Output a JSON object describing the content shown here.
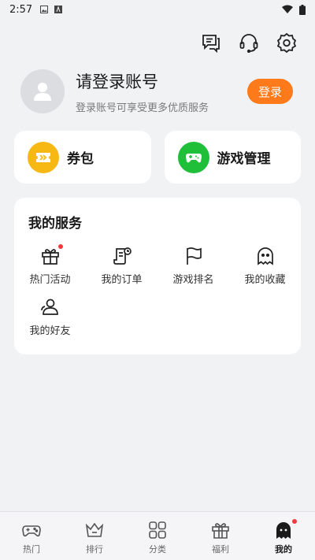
{
  "status_bar": {
    "time": "2:57"
  },
  "header": {
    "icons": [
      "message-icon",
      "headset-icon",
      "settings-icon"
    ]
  },
  "profile": {
    "title": "请登录账号",
    "subtitle": "登录账号可享受更多优质服务",
    "login_label": "登录"
  },
  "quick_cards": [
    {
      "label": "券包",
      "icon": "ticket-icon",
      "color": "#f8b814"
    },
    {
      "label": "游戏管理",
      "icon": "gamepad-icon",
      "color": "#1fbf3a"
    }
  ],
  "services": {
    "title": "我的服务",
    "items": [
      {
        "label": "热门活动",
        "icon": "gift-icon",
        "badge": true
      },
      {
        "label": "我的订单",
        "icon": "order-icon",
        "badge": false
      },
      {
        "label": "游戏排名",
        "icon": "flag-icon",
        "badge": false
      },
      {
        "label": "我的收藏",
        "icon": "ghost-icon",
        "badge": false
      },
      {
        "label": "我的好友",
        "icon": "friends-icon",
        "badge": false
      }
    ]
  },
  "bottom_nav": [
    {
      "label": "热门",
      "icon": "gamepad-icon",
      "active": false
    },
    {
      "label": "排行",
      "icon": "crown-icon",
      "active": false
    },
    {
      "label": "分类",
      "icon": "grid-icon",
      "active": false
    },
    {
      "label": "福利",
      "icon": "gift-icon",
      "active": false
    },
    {
      "label": "我的",
      "icon": "ghost-icon",
      "active": true,
      "badge": true
    }
  ],
  "colors": {
    "accent": "#ff7a1a",
    "background": "#f1f2f4",
    "badge": "#f23a3a"
  }
}
